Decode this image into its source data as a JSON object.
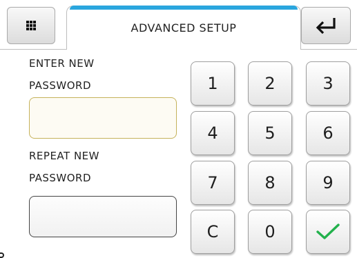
{
  "header": {
    "menu_icon": "grid-menu-icon",
    "title": "ADVANCED SETUP",
    "back_icon": "enter-return-icon",
    "accent_color": "#2aa6de"
  },
  "form": {
    "new_password_label": "ENTER NEW\nPASSWORD",
    "new_password_value": "",
    "repeat_password_label": "REPEAT NEW\nPASSWORD",
    "repeat_password_value": "",
    "active_field_border_color": "#c5b25a"
  },
  "keypad": {
    "keys": [
      "1",
      "2",
      "3",
      "4",
      "5",
      "6",
      "7",
      "8",
      "9",
      "C",
      "0"
    ],
    "confirm_icon": "checkmark-icon",
    "confirm_color": "#22b14c"
  }
}
